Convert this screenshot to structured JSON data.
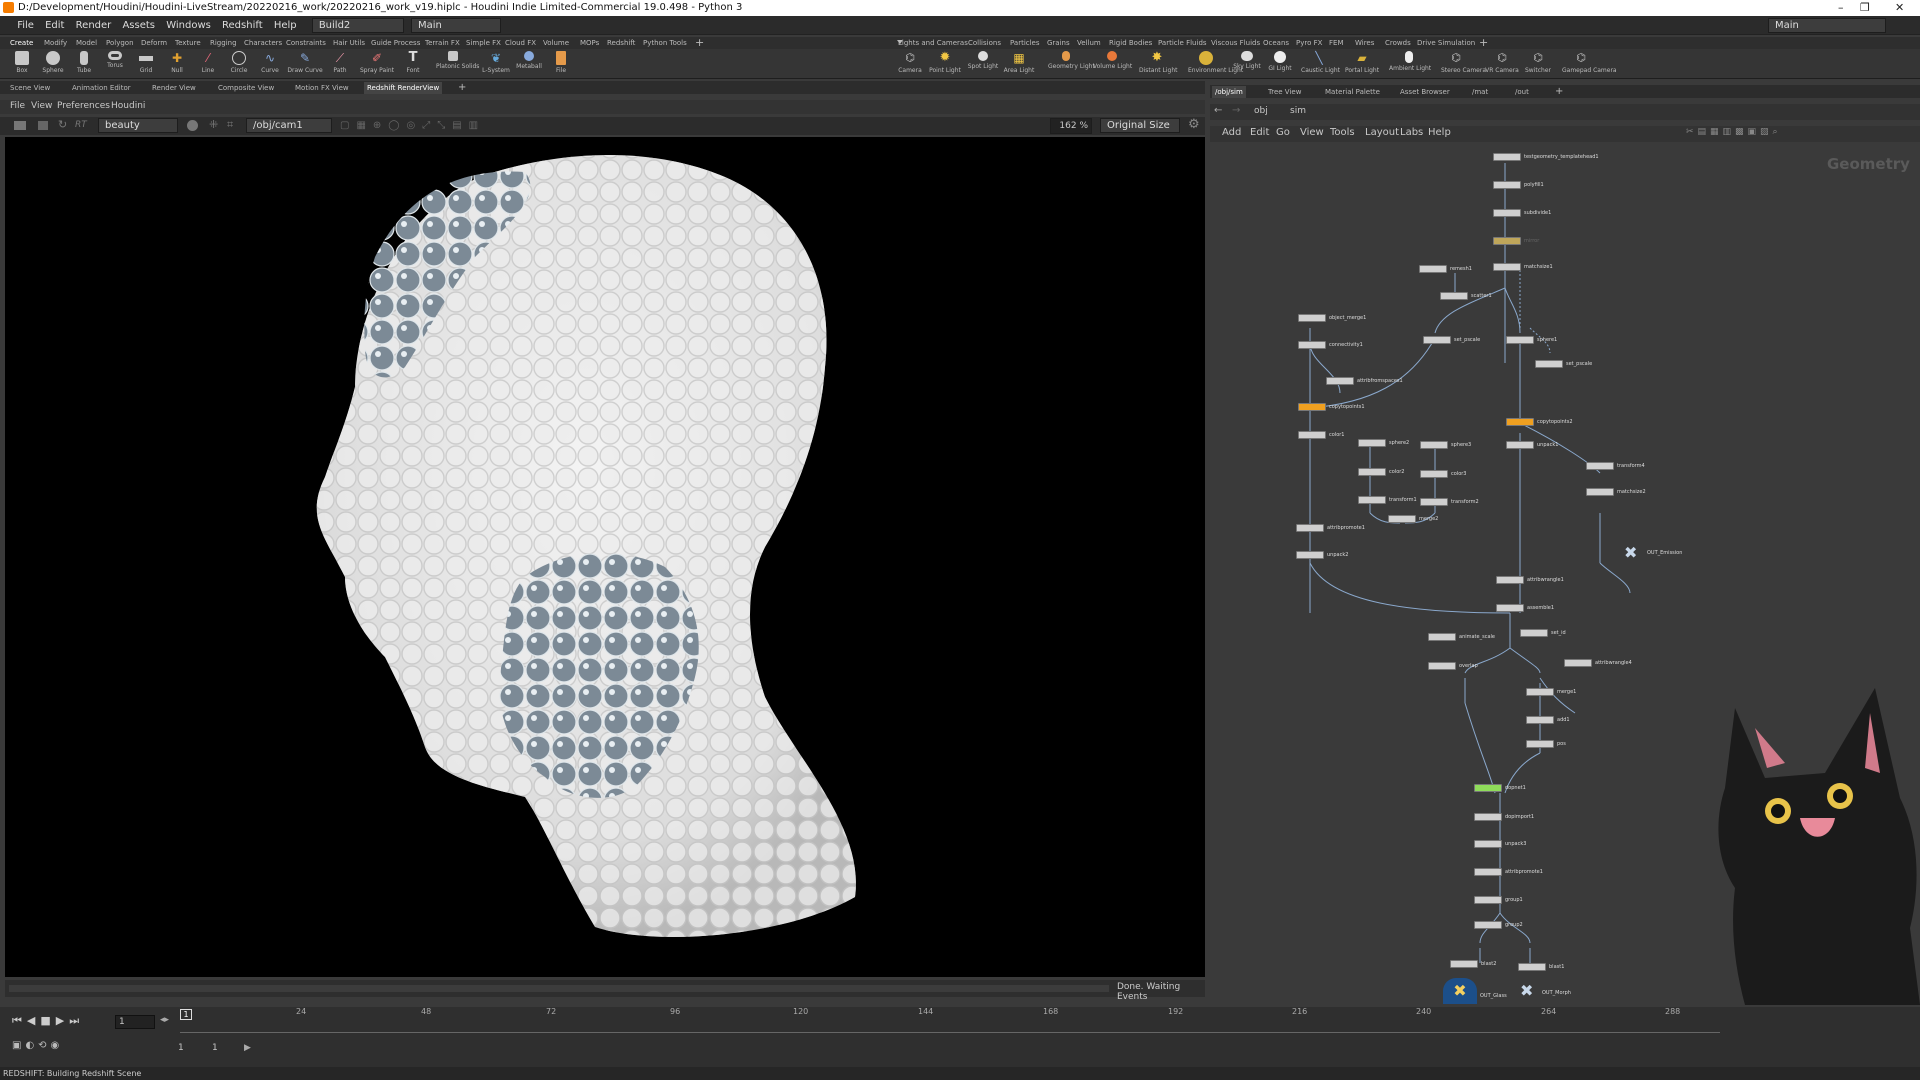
{
  "window": {
    "title": "D:/Development/Houdini/Houdini-LiveStream/20220216_work/20220216_work_v19.hiplc - Houdini Indie Limited-Commercial 19.0.498 - Python 3",
    "minimize": "–",
    "restore": "❐",
    "close": "✕"
  },
  "menu": [
    "File",
    "Edit",
    "Render",
    "Assets",
    "Windows",
    "Redshift",
    "Help"
  ],
  "build": "Build2",
  "desktop": "Main",
  "desktop_right": "Main",
  "shelf_tabs_left": [
    "Create",
    "Modify",
    "Model",
    "Polygon",
    "Deform",
    "Texture",
    "Rigging",
    "Characters",
    "Constraints",
    "Hair Utils",
    "Guide Process",
    "Terrain FX",
    "Simple FX",
    "Cloud FX",
    "Volume",
    "MOPs",
    "Redshift",
    "Python Tools"
  ],
  "shelf_tabs_right": [
    "Lights and Cameras",
    "Collisions",
    "Particles",
    "Grains",
    "Vellum",
    "Rigid Bodies",
    "Particle Fluids",
    "Viscous Fluids",
    "Oceans",
    "Pyro FX",
    "FEM",
    "Wires",
    "Crowds",
    "Drive Simulation"
  ],
  "tools_left": [
    "Box",
    "Sphere",
    "Tube",
    "Torus",
    "Grid",
    "Null",
    "Line",
    "Circle",
    "Curve",
    "Draw Curve",
    "Path",
    "Spray Paint",
    "Font",
    "Platonic Solids",
    "L-System",
    "Metaball",
    "File"
  ],
  "tools_right": [
    "Camera",
    "Point Light",
    "Spot Light",
    "Area Light",
    "Geometry Light",
    "Volume Light",
    "Distant Light",
    "Environment Light",
    "Sky Light",
    "GI Light",
    "Caustic Light",
    "Portal Light",
    "Ambient Light",
    "Stereo Camera",
    "VR Camera",
    "Switcher",
    "Gamepad Camera"
  ],
  "pane_tabs_left": [
    "Scene View",
    "Animation Editor",
    "Render View",
    "Composite View",
    "Motion FX View",
    "Redshift RenderView"
  ],
  "pane_tabs_right": [
    "/obj/sim",
    "Tree View",
    "Material Palette",
    "Asset Browser",
    "/mat",
    "/out"
  ],
  "rs_menu": [
    "File",
    "View",
    "Preferences",
    "Houdini"
  ],
  "aov": "beauty",
  "camera": "/obj/cam1",
  "zoom": "162 %",
  "size_mode": "Original Size",
  "rs_status": "Done. Waiting Events",
  "path_obj": "obj",
  "path_sim": "sim",
  "net_menu": [
    "Add",
    "Edit",
    "Go",
    "View",
    "Tools",
    "Layout",
    "Labs",
    "Help"
  ],
  "net_label": "Geometry",
  "nodes": [
    {
      "n": "testgeometry_templatehead1"
    },
    {
      "n": "polyfill1"
    },
    {
      "n": "subdivide1"
    },
    {
      "n": "mirror"
    },
    {
      "n": "remesh1"
    },
    {
      "n": "matchsize1"
    },
    {
      "n": "scatter1"
    },
    {
      "n": "object_merge1"
    },
    {
      "n": "copytopoints1"
    },
    {
      "n": "connectivity1"
    },
    {
      "n": "attribfromspaces1"
    },
    {
      "n": "set_pscale"
    },
    {
      "n": "sphere1"
    },
    {
      "n": "copytopoints2"
    },
    {
      "n": "color1"
    },
    {
      "n": "sphere2"
    },
    {
      "n": "sphere3"
    },
    {
      "n": "color2"
    },
    {
      "n": "color3"
    },
    {
      "n": "transform1"
    },
    {
      "n": "transform2"
    },
    {
      "n": "merge2"
    },
    {
      "n": "attribpromote1"
    },
    {
      "n": "unpack2"
    },
    {
      "n": "unpack1"
    },
    {
      "n": "transform4"
    },
    {
      "n": "matchsize2"
    },
    {
      "n": "OUT_Emission"
    },
    {
      "n": "attribwrangle1"
    },
    {
      "n": "assemble1"
    },
    {
      "n": "animate_scale"
    },
    {
      "n": "set_id"
    },
    {
      "n": "overlap"
    },
    {
      "n": "attribwrangle4"
    },
    {
      "n": "merge1"
    },
    {
      "n": "add1"
    },
    {
      "n": "pos"
    },
    {
      "n": "dopnet1"
    },
    {
      "n": "dopimport1"
    },
    {
      "n": "unpack3"
    },
    {
      "n": "attribpromote1"
    },
    {
      "n": "group1"
    },
    {
      "n": "group2"
    },
    {
      "n": "blast2"
    },
    {
      "n": "blast1"
    },
    {
      "n": "OUT_Glass"
    },
    {
      "n": "OUT_Morph"
    }
  ],
  "timeline": {
    "frame": "1",
    "ticks": [
      "24",
      "48",
      "72",
      "96",
      "120",
      "144",
      "168",
      "192",
      "216",
      "240",
      "264",
      "288"
    ],
    "start": "1",
    "end": "1"
  },
  "status": "REDSHIFT: Building Redshift Scene"
}
